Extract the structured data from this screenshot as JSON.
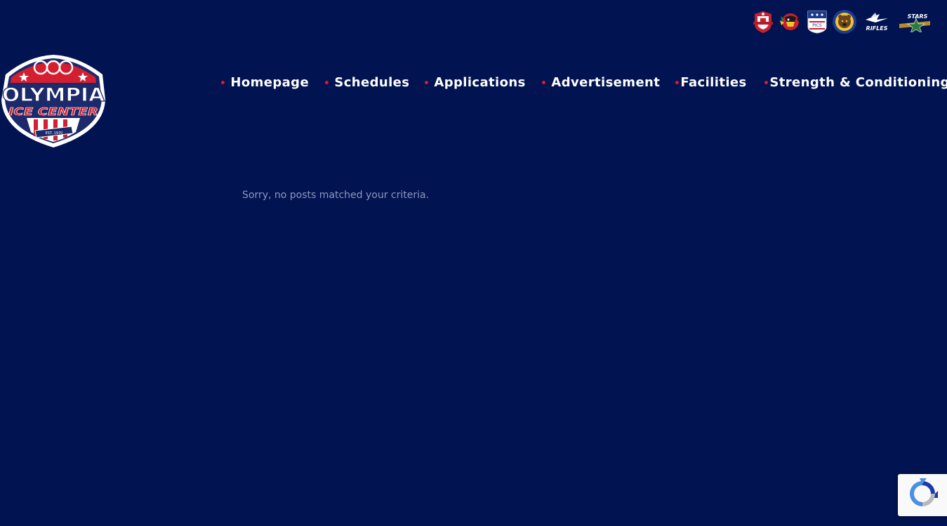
{
  "team_logos": [
    {
      "icon": "club-crest-red-icon"
    },
    {
      "icon": "blackhawks-head-icon"
    },
    {
      "icon": "pics-shield-icon",
      "text": "PICS"
    },
    {
      "icon": "bear-medallion-icon"
    },
    {
      "icon": "rifles-jet-icon",
      "text": "RIFLES"
    },
    {
      "icon": "stars-star-icon",
      "text": "STARS"
    }
  ],
  "logo": {
    "title": "OLYMPIA",
    "subtitle": "ICE CENTER",
    "established": "EST. 1970"
  },
  "nav": {
    "bullet": "•",
    "items": [
      {
        "label": "Homepage"
      },
      {
        "label": "Schedules"
      },
      {
        "label": "Applications"
      },
      {
        "label": "Advertisement"
      },
      {
        "label": "Facilities"
      },
      {
        "label": "Strength & Conditioning"
      }
    ]
  },
  "content": {
    "empty_message": "Sorry, no posts matched your criteria."
  },
  "recaptcha": {
    "icon": "recaptcha-icon"
  },
  "colors": {
    "background": "#011350",
    "accent": "#e0192c",
    "nav_text": "#ffffff",
    "muted_text": "#8e98c0"
  }
}
